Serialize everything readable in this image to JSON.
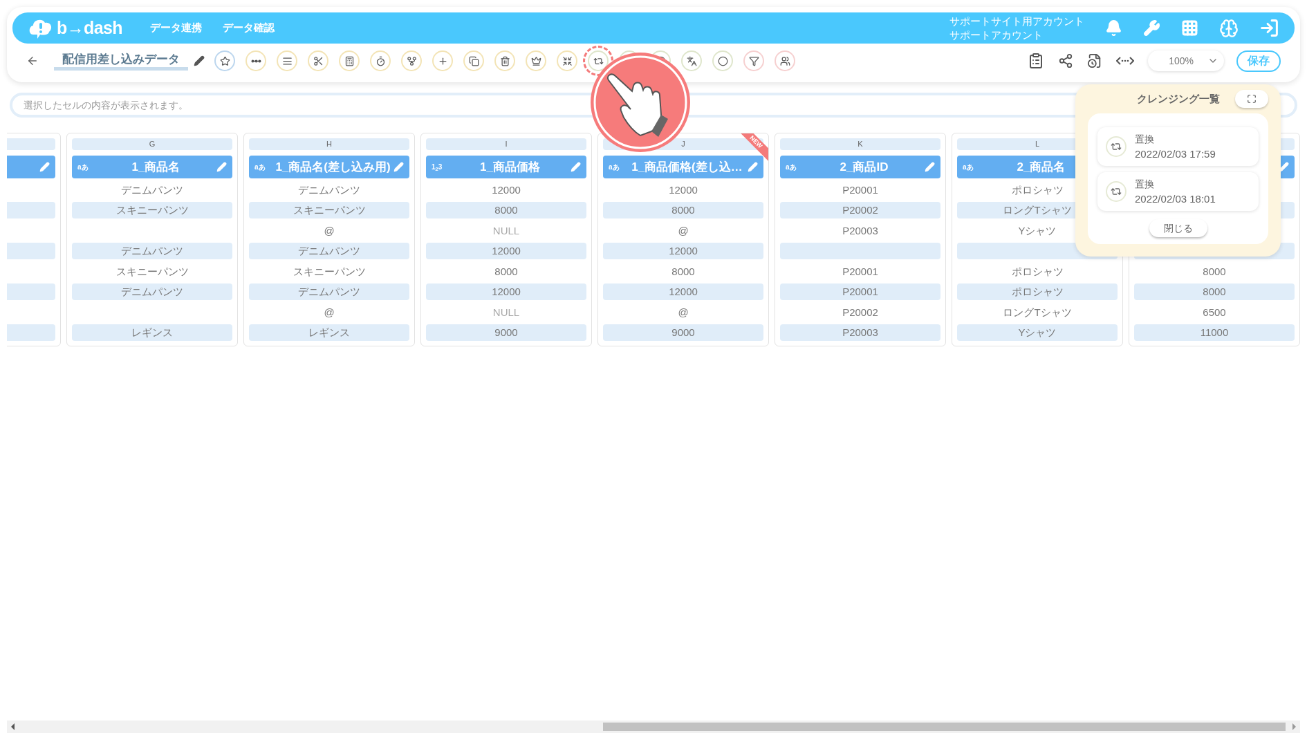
{
  "header": {
    "logo": "b→dash",
    "nav": [
      {
        "label": "データ連携"
      },
      {
        "label": "データ確認"
      }
    ],
    "account": {
      "line1": "サポートサイト用アカウント",
      "line2": "サポートアカウント"
    }
  },
  "toolbar": {
    "file_name": "配信用差し込みデータ",
    "tools": [
      {
        "color": "#bcd6ee",
        "highlighted": false
      },
      {
        "color": "#f3e4b6",
        "highlighted": false
      },
      {
        "color": "#f3e4b6",
        "highlighted": false
      },
      {
        "color": "#f3e4b6",
        "highlighted": false
      },
      {
        "color": "#f3e4b6",
        "highlighted": false
      },
      {
        "color": "#f3e4b6",
        "highlighted": false
      },
      {
        "color": "#f3e4b6",
        "highlighted": false
      },
      {
        "color": "#f3e4b6",
        "highlighted": false
      },
      {
        "color": "#f3e4b6",
        "highlighted": false
      },
      {
        "color": "#f3e4b6",
        "highlighted": false
      },
      {
        "color": "#f3e4b6",
        "highlighted": false
      },
      {
        "color": "#f3e4b6",
        "highlighted": false
      },
      {
        "color": "#dfe6cc",
        "highlighted": true
      },
      {
        "color": "#dfe6cc",
        "highlighted": false
      },
      {
        "color": "#dfe6cc",
        "highlighted": false
      },
      {
        "color": "#dfe6cc",
        "highlighted": false
      },
      {
        "color": "#dfe6cc",
        "highlighted": false
      },
      {
        "color": "#f6d0d0",
        "highlighted": false
      },
      {
        "color": "#f6d0d0",
        "highlighted": false
      }
    ],
    "zoom": "100%",
    "save": "保存"
  },
  "cell_view": {
    "placeholder": "選択したセルの内容が表示されます。"
  },
  "columns": [
    {
      "cells": [
        null,
        null,
        null,
        null,
        null,
        null,
        null,
        null
      ]
    },
    {
      "letter": "G",
      "type_label": "aあ",
      "title": "1_商品名",
      "cells": [
        "デニムパンツ",
        "スキニーパンツ",
        null,
        "デニムパンツ",
        "スキニーパンツ",
        "デニムパンツ",
        null,
        "レギンス"
      ]
    },
    {
      "letter": "H",
      "type_label": "aあ",
      "title": "1_商品名(差し込み用)",
      "cells": [
        "デニムパンツ",
        "スキニーパンツ",
        "@",
        "デニムパンツ",
        "スキニーパンツ",
        "デニムパンツ",
        "@",
        "レギンス"
      ]
    },
    {
      "letter": "I",
      "type_label": "1$_{2}$3",
      "title": "1_商品価格",
      "cells": [
        "12000",
        "8000",
        {
          "text": "NULL",
          "kind": "null"
        },
        "12000",
        "8000",
        "12000",
        {
          "text": "NULL",
          "kind": "null"
        },
        "9000"
      ]
    },
    {
      "letter": "J",
      "type_label": "aあ",
      "title": "1_商品価格(差し込…",
      "badge": "NEW",
      "cells": [
        "12000",
        "8000",
        "@",
        "12000",
        "8000",
        "12000",
        "@",
        "9000"
      ]
    },
    {
      "letter": "K",
      "type_label": "aあ",
      "title": "2_商品ID",
      "cells": [
        "P20001",
        "P20002",
        "P20003",
        null,
        "P20001",
        "P20001",
        "P20002",
        "P20003"
      ]
    },
    {
      "letter": "L",
      "type_label": "aあ",
      "title": "2_商品名",
      "cells": [
        "ポロシャツ",
        "ロングTシャツ",
        "Yシャツ",
        null,
        "ポロシャツ",
        "ポロシャツ",
        "ロングTシャツ",
        "Yシャツ"
      ]
    },
    {
      "cells": [
        null,
        null,
        null,
        null,
        "8000",
        "8000",
        "6500",
        "11000"
      ]
    }
  ],
  "cleansing_panel": {
    "title": "クレンジング一覧",
    "items": [
      {
        "name": "置換",
        "time": "2022/02/03 17:59"
      },
      {
        "name": "置換",
        "time": "2022/02/03 18:01"
      }
    ],
    "close": "閉じる"
  }
}
